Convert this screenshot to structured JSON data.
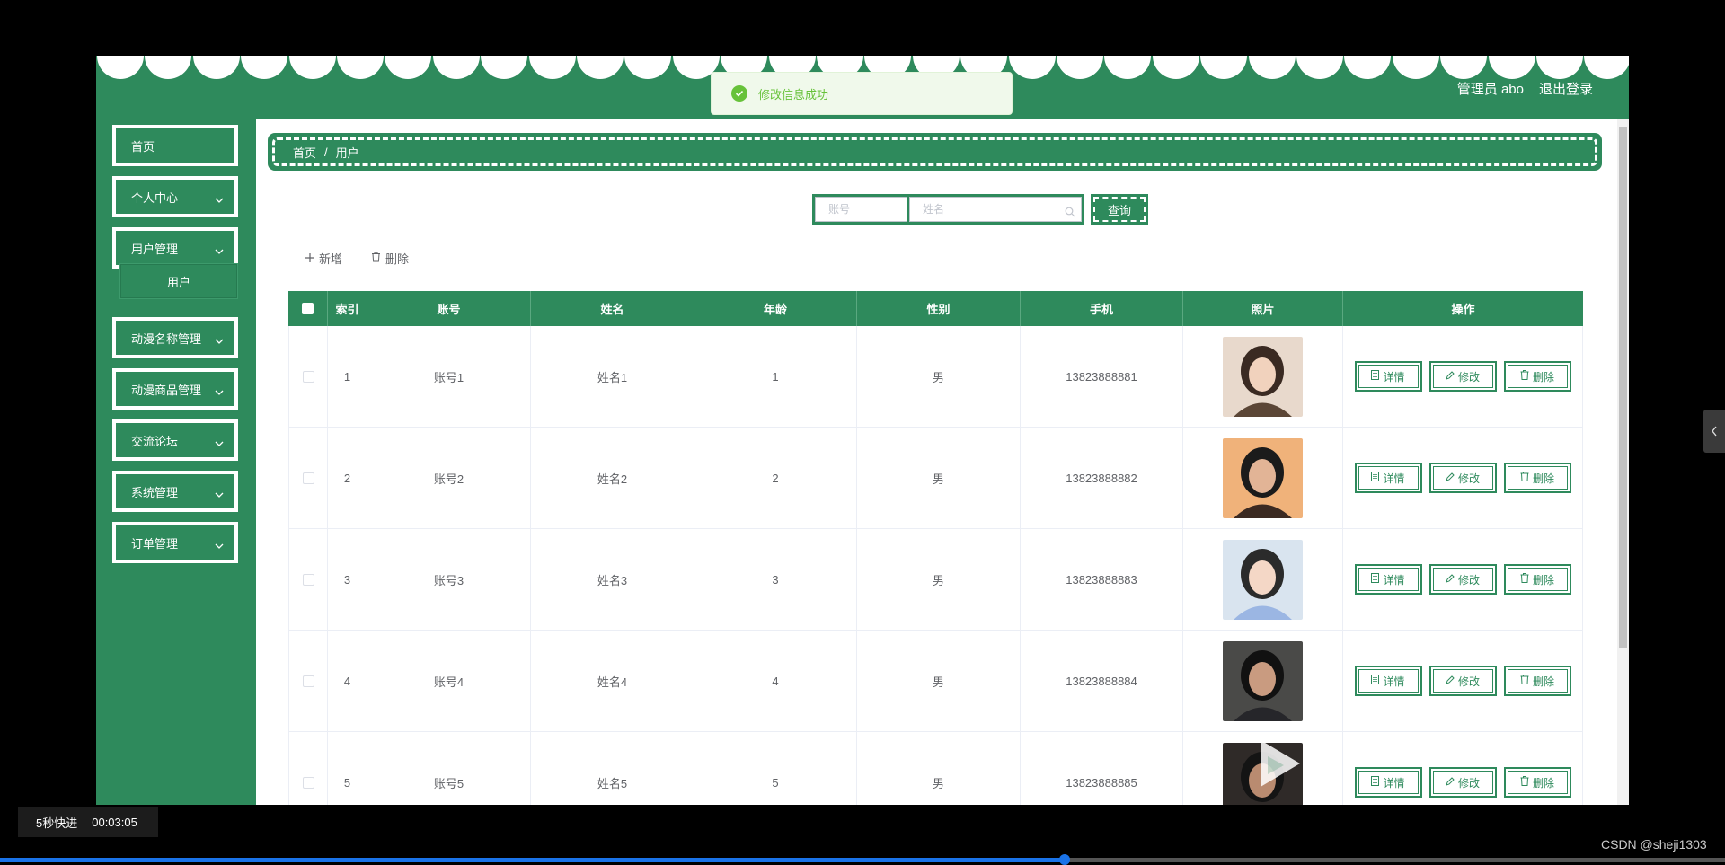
{
  "header": {
    "user": "管理员 abo",
    "logout": "退出登录"
  },
  "toast": {
    "message": "修改信息成功"
  },
  "sidebar": {
    "items": [
      {
        "label": "首页"
      },
      {
        "label": "个人中心"
      },
      {
        "label": "用户管理"
      },
      {
        "label": "动漫名称管理"
      },
      {
        "label": "动漫商品管理"
      },
      {
        "label": "交流论坛"
      },
      {
        "label": "系统管理"
      },
      {
        "label": "订单管理"
      }
    ],
    "sub_item": "用户"
  },
  "breadcrumb": {
    "home": "首页",
    "sep": "/",
    "current": "用户"
  },
  "search": {
    "account_placeholder": "账号",
    "name_placeholder": "姓名",
    "button": "查询"
  },
  "toolbar": {
    "add": "新增",
    "delete": "删除"
  },
  "table": {
    "headers": [
      "索引",
      "账号",
      "姓名",
      "年龄",
      "性别",
      "手机",
      "照片",
      "操作"
    ],
    "ops": [
      "详情",
      "修改",
      "删除"
    ],
    "rows": [
      {
        "idx": "1",
        "account": "账号1",
        "name": "姓名1",
        "age": "1",
        "sex": "男",
        "phone": "13823888881"
      },
      {
        "idx": "2",
        "account": "账号2",
        "name": "姓名2",
        "age": "2",
        "sex": "男",
        "phone": "13823888882"
      },
      {
        "idx": "3",
        "account": "账号3",
        "name": "姓名3",
        "age": "3",
        "sex": "男",
        "phone": "13823888883"
      },
      {
        "idx": "4",
        "account": "账号4",
        "name": "姓名4",
        "age": "4",
        "sex": "男",
        "phone": "13823888884"
      },
      {
        "idx": "5",
        "account": "账号5",
        "name": "姓名5",
        "age": "5",
        "sex": "男",
        "phone": "13823888885"
      }
    ]
  },
  "player": {
    "label": "5秒快进",
    "time": "00:03:05",
    "progress": 0.617
  },
  "watermark": "CSDN @sheji1303",
  "colors": {
    "primary": "#2e8a5c",
    "success": "#67c23a"
  }
}
